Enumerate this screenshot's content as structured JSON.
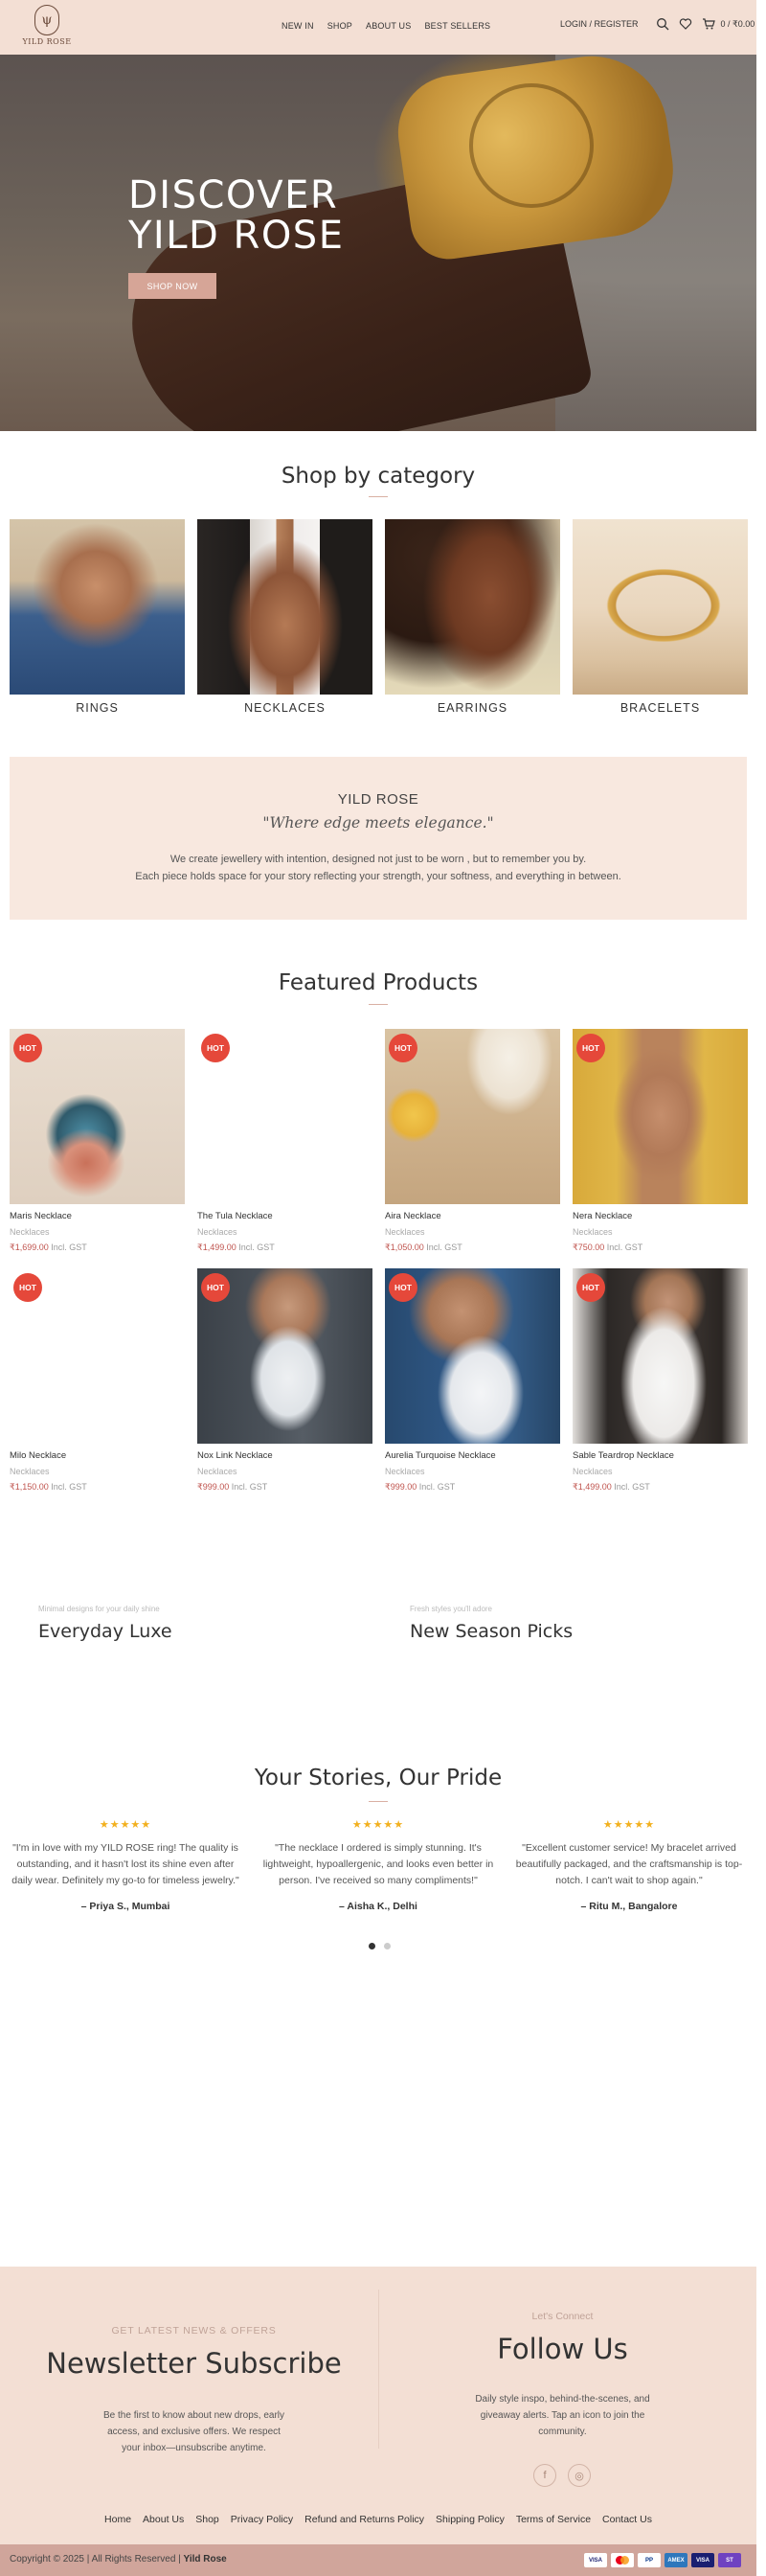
{
  "header": {
    "logo_text": "YILD ROSE",
    "logo_mark": "ψ",
    "nav": [
      "NEW IN",
      "SHOP",
      "ABOUT US",
      "BEST SELLERS"
    ],
    "login": "LOGIN / REGISTER",
    "cart_total": "0 / ₹0.00",
    "icons": [
      "search-icon",
      "heart-icon",
      "cart-icon"
    ]
  },
  "hero": {
    "title_line1": "DISCOVER",
    "title_line2": "YILD ROSE",
    "button": "SHOP NOW"
  },
  "categories": {
    "title": "Shop by category",
    "items": [
      "RINGS",
      "NECKLACES",
      "EARRINGS",
      "BRACELETS"
    ]
  },
  "about": {
    "title": "YILD ROSE",
    "tagline": "\"Where edge meets elegance.\"",
    "line1": "We create jewellery with intention, designed not just to be worn , but to remember you by.",
    "line2": "Each piece holds space for your story reflecting your strength, your softness, and everything in between."
  },
  "featured": {
    "title": "Featured Products",
    "badge": "HOT",
    "suffix": "Incl. GST",
    "products": [
      {
        "name": "Maris Necklace",
        "category": "Necklaces",
        "price": "₹1,699.00"
      },
      {
        "name": "The Tula Necklace",
        "category": "Necklaces",
        "price": "₹1,499.00"
      },
      {
        "name": "Aira Necklace",
        "category": "Necklaces",
        "price": "₹1,050.00"
      },
      {
        "name": "Nera Necklace",
        "category": "Necklaces",
        "price": "₹750.00"
      },
      {
        "name": "Milo Necklace",
        "category": "Necklaces",
        "price": "₹1,150.00"
      },
      {
        "name": "Nox Link Necklace",
        "category": "Necklaces",
        "price": "₹999.00"
      },
      {
        "name": "Aurelia Turquoise Necklace",
        "category": "Necklaces",
        "price": "₹999.00"
      },
      {
        "name": "Sable Teardrop Necklace",
        "category": "Necklaces",
        "price": "₹1,499.00"
      }
    ]
  },
  "promos": [
    {
      "sub": "Minimal designs for your daily shine",
      "title": "Everyday Luxe"
    },
    {
      "sub": "Fresh styles you'll adore",
      "title": "New Season Picks"
    }
  ],
  "testimonials": {
    "title": "Your Stories, Our Pride",
    "stars": "★★★★★",
    "items": [
      {
        "quote": "\"I'm in love with my YILD ROSE ring! The quality is outstanding, and it hasn't lost its shine even after daily wear. Definitely my go-to for timeless jewelry.\"",
        "author": "– Priya S., Mumbai"
      },
      {
        "quote": "\"The necklace I ordered is simply stunning. It's lightweight, hypoallergenic, and looks even better in person. I've received so many compliments!\"",
        "author": "– Aisha K., Delhi"
      },
      {
        "quote": "\"Excellent customer service! My bracelet arrived beautifully packaged, and the craftsmanship is top-notch. I can't wait to shop again.\"",
        "author": "– Ritu M., Bangalore"
      }
    ]
  },
  "newsletter": {
    "sub": "GET LATEST NEWS & OFFERS",
    "title": "Newsletter Subscribe",
    "body": "Be the first to know about new drops, early access, and exclusive offers. We respect your inbox—unsubscribe anytime."
  },
  "follow": {
    "sub": "Let's Connect",
    "title": "Follow Us",
    "body": "Daily style inspo, behind-the-scenes, and giveaway alerts. Tap an icon to join the community.",
    "facebook_glyph": "f",
    "instagram_glyph": "◎"
  },
  "footer": {
    "links": [
      "Home",
      "About Us",
      "Shop",
      "Privacy Policy",
      "Refund and Returns Policy",
      "Shipping Policy",
      "Terms of Service",
      "Contact Us"
    ],
    "copyright": "Copyright © 2025 | All Rights Reserved |",
    "brand": "Yild Rose",
    "payments": [
      "VISA",
      "MC",
      "PP",
      "AMEX",
      "VISA",
      "ST"
    ]
  },
  "colors": {
    "header_bg": "#f3dfd4",
    "accent": "#d6a597",
    "badge": "#e5483a",
    "price": "#c0554f",
    "footer_bottom": "#d0a59b"
  }
}
